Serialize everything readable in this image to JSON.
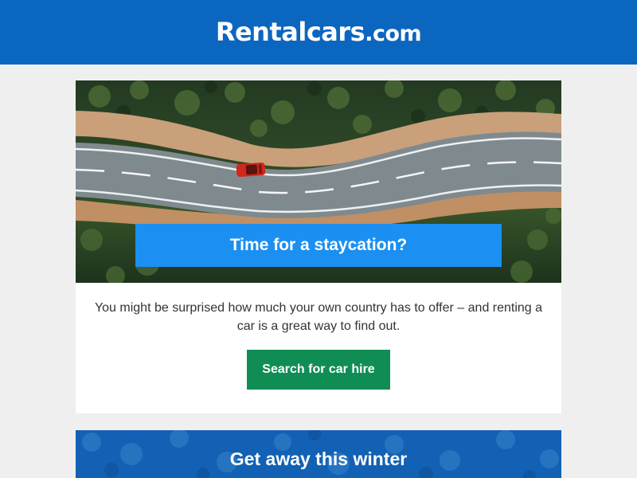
{
  "header": {
    "logo_main": "Rentalcars",
    "logo_suffix": ".com"
  },
  "hero": {
    "image_name": "aerial-road-with-red-car",
    "title": "Time for a staycation?"
  },
  "promo": {
    "text": "You might be surprised how much your own country has to offer – and renting a car is a great way to find out.",
    "cta_label": "Search for car hire"
  },
  "second_card": {
    "title": "Get away this winter"
  },
  "colors": {
    "header_bg": "#0b66bf",
    "hero_title_bg": "#1b8ff2",
    "cta_bg": "#0f8d55",
    "page_bg": "#efefef"
  }
}
